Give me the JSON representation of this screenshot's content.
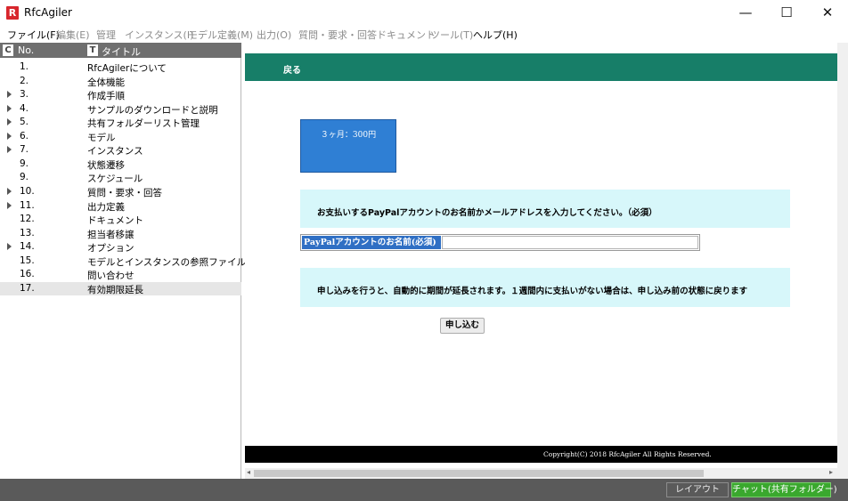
{
  "window": {
    "title": "RfcAgiler",
    "logo_letter": "R",
    "minimize": "—",
    "maximize": "☐",
    "close": "✕"
  },
  "menu": [
    {
      "label": "ファイル(F)",
      "enabled": true
    },
    {
      "label": "編集(E)",
      "enabled": false
    },
    {
      "label": "管理",
      "enabled": false
    },
    {
      "label": "インスタンス(I)",
      "enabled": false
    },
    {
      "label": "モデル定義(M)",
      "enabled": false
    },
    {
      "label": "出力(O)",
      "enabled": false
    },
    {
      "label": "質問・要求・回答",
      "enabled": false
    },
    {
      "label": "ドキュメント",
      "enabled": false
    },
    {
      "label": "ツール(T)",
      "enabled": false
    },
    {
      "label": "ヘルプ(H)",
      "enabled": true
    }
  ],
  "tree": {
    "header": {
      "no_icon": "C",
      "no_label": "No.",
      "title_icon": "T",
      "title_label": "タイトル"
    },
    "rows": [
      {
        "no": "1.",
        "title": "RfcAgilerについて",
        "expandable": false
      },
      {
        "no": "2.",
        "title": "全体機能",
        "expandable": false
      },
      {
        "no": "3.",
        "title": "作成手順",
        "expandable": true
      },
      {
        "no": "4.",
        "title": "サンプルのダウンロードと説明",
        "expandable": true
      },
      {
        "no": "5.",
        "title": "共有フォルダーリスト管理",
        "expandable": true
      },
      {
        "no": "6.",
        "title": "モデル",
        "expandable": true
      },
      {
        "no": "7.",
        "title": "インスタンス",
        "expandable": true
      },
      {
        "no": "9.",
        "title": "状態遷移",
        "expandable": false
      },
      {
        "no": "9.",
        "title": "スケジュール",
        "expandable": false
      },
      {
        "no": "10.",
        "title": "質問・要求・回答",
        "expandable": true
      },
      {
        "no": "11.",
        "title": "出力定義",
        "expandable": true
      },
      {
        "no": "12.",
        "title": "ドキュメント",
        "expandable": false
      },
      {
        "no": "13.",
        "title": "担当者移譲",
        "expandable": false
      },
      {
        "no": "14.",
        "title": "オプション",
        "expandable": true
      },
      {
        "no": "15.",
        "title": "モデルとインスタンスの参照ファイルと…",
        "expandable": false
      },
      {
        "no": "16.",
        "title": "問い合わせ",
        "expandable": false
      },
      {
        "no": "17.",
        "title": "有効期限延長",
        "expandable": false,
        "selected": true
      }
    ]
  },
  "content": {
    "back_label": "戻る",
    "plan_label": "３ヶ月：300円",
    "instruction": "お支払いするPayPalアカウントのお名前かメールアドレスを入力してください。（必須）",
    "name_label": "PayPalアカウントのお名前(必須)",
    "name_value": "",
    "notice": "申し込みを行うと、自動的に期間が延長されます。１週間内に支払いがない場合は、申し込み前の状態に戻ります",
    "apply_label": "申し込む",
    "copyright": "Copyright(C) 2018 RfcAgiler All Rights Reserved."
  },
  "statusbar": {
    "layout_label": "レイアウト",
    "chat_label": "チャット(共有フォルダー)"
  },
  "colors": {
    "accent_green": "#177e68",
    "plan_blue": "#2f7fd4",
    "info_bg": "#d7f7fa",
    "chat_green": "#3aa82e"
  }
}
